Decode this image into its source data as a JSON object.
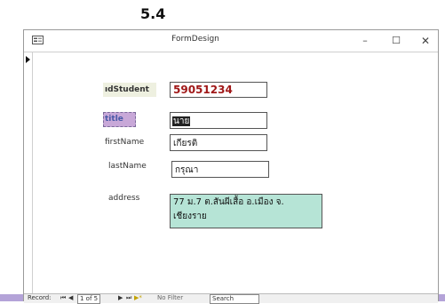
{
  "caption": "5.4",
  "window": {
    "title": "FormDesign",
    "minimize_icon": "–",
    "maximize_icon": "☐",
    "close_icon": "✕"
  },
  "form": {
    "idstudent": {
      "label": "ıdStudent",
      "value": "59051234"
    },
    "title": {
      "label": "title",
      "value": "นาย"
    },
    "firstname": {
      "label": "firstName",
      "value": "เกียรติ"
    },
    "lastname": {
      "label": "lastName",
      "value": "กรุณา"
    },
    "address": {
      "label": "address",
      "value": "77 ม.7 ต.สันผีเสื้อ อ.เมือง จ. เชียงราย"
    }
  },
  "navbar": {
    "record_label": "Record:",
    "first_icon": "⏮",
    "prev_icon": "◀",
    "position": "1 of 5",
    "next_icon": "▶",
    "last_icon": "⏭",
    "new_icon": "▶*",
    "filter_label": "No Filter",
    "search_label": "Search"
  },
  "colors": {
    "id_value": "#a01818",
    "address_bg": "#b6e4d6",
    "title_label_bg": "#c8a8d8",
    "id_label_bg": "#eef0e0",
    "side_strip": "#b4a3d8"
  }
}
